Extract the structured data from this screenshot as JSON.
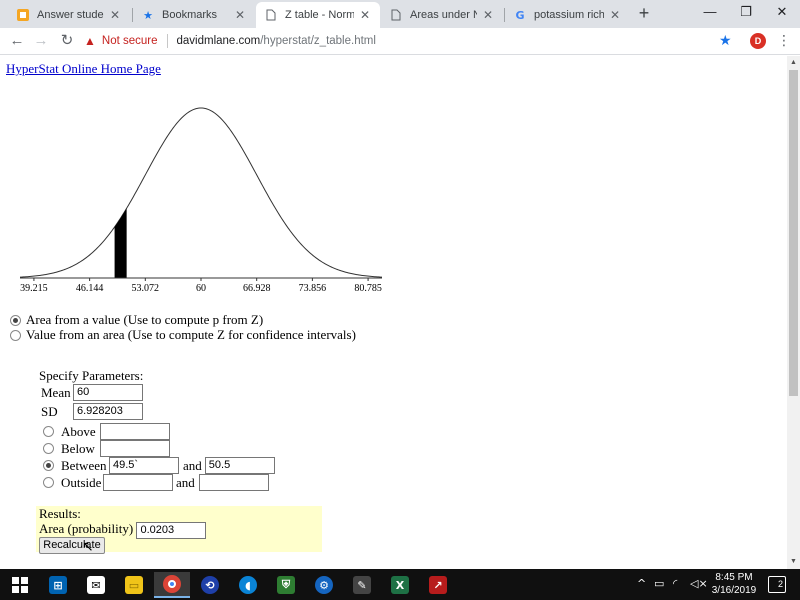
{
  "browser": {
    "tabs": [
      {
        "label": "Answer students'",
        "icon": "chegg-icon"
      },
      {
        "label": "Bookmarks",
        "icon": "star-icon"
      },
      {
        "label": "Z table - Normal",
        "icon": "page-icon",
        "active": true
      },
      {
        "label": "Areas under Norm",
        "icon": "page-icon"
      },
      {
        "label": "potassium rich fo",
        "icon": "google-icon"
      }
    ],
    "security_label": "Not secure",
    "url_host": "davidmlane.com",
    "url_path": "/hyperstat/z_table.html",
    "avatar_letter": "D",
    "accent": "#1a73e8"
  },
  "page": {
    "home_link": "HyperStat Online Home Page",
    "axis_ticks": [
      "39.215",
      "46.144",
      "53.072",
      "60",
      "66.928",
      "73.856",
      "80.785"
    ],
    "modes": [
      {
        "label": "Area from a value (Use to compute p from Z)",
        "selected": true
      },
      {
        "label": "Value from an area (Use to compute Z for confidence intervals)",
        "selected": false
      }
    ],
    "params_title": "Specify Parameters:",
    "mean_label": "Mean",
    "mean_value": "60",
    "sd_label": "SD",
    "sd_value": "6.928203",
    "above_label": "Above",
    "above_value": "",
    "below_label": "Below",
    "below_value": "",
    "between_label": "Between",
    "between_low": "49.5`",
    "and_label": "and",
    "between_high": "50.5",
    "outside_label": "Outside",
    "outside_low": "",
    "outside_high": "",
    "selected_option": "between",
    "results_title": "Results:",
    "area_label": "Area (probability)",
    "area_value": "0.0203",
    "recalc_label": "Recalculate",
    "shade_color": "#000000",
    "results_bg": "#ffffcc"
  },
  "taskbar": {
    "time": "8:45 PM",
    "date": "3/16/2019",
    "notifications": "2"
  }
}
